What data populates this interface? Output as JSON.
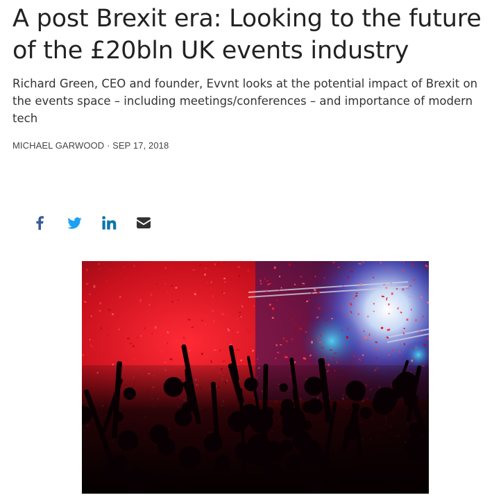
{
  "article": {
    "headline": "A post Brexit era: Looking to the future of the £20bln UK events industry",
    "dek": "Richard Green, CEO and founder, Evvnt looks at the potential impact of Brexit on the  events space – including meetings/conferences – and importance of modern tech",
    "author": "MICHAEL GARWOOD",
    "separator": "·",
    "date": "SEP 17, 2018"
  },
  "share": {
    "items": [
      {
        "icon": "facebook-icon",
        "color": "#3b5998"
      },
      {
        "icon": "twitter-icon",
        "color": "#1da1f2"
      },
      {
        "icon": "linkedin-icon",
        "color": "#0e76a8"
      },
      {
        "icon": "email-icon",
        "color": "#333333"
      }
    ]
  },
  "hero_image": {
    "subject": "concert crowd with red confetti and stage lights"
  }
}
